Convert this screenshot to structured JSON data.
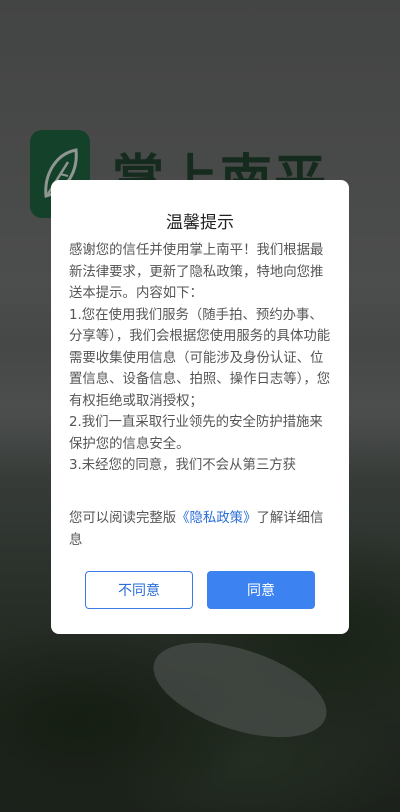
{
  "app": {
    "name": "掌上南平"
  },
  "dialog": {
    "title": "温馨提示",
    "paragraphs": [
      "感谢您的信任并使用掌上南平！我们根据最新法律要求，更新了隐私政策，特地向您推送本提示。内容如下：",
      "1.您在使用我们服务（随手拍、预约办事、分享等），我们会根据您使用服务的具体功能需要收集使用信息（可能涉及身份认证、位置信息、设备信息、拍照、操作日志等），您有权拒绝或取消授权；",
      "2.我们一直采取行业领先的安全防护措施来保护您的信息安全。",
      "3.未经您的同意，我们不会从第三方获"
    ],
    "read_more_prefix": "您可以阅读完整版",
    "policy_link": "《隐私政策》",
    "read_more_suffix": "了解详细信息",
    "buttons": {
      "disagree": "不同意",
      "agree": "同意"
    }
  },
  "colors": {
    "accent": "#3c82f0",
    "link": "#2a6dd9",
    "brand_green": "#1f6a43"
  },
  "icons": {
    "logo": "leaf-logo-icon"
  }
}
